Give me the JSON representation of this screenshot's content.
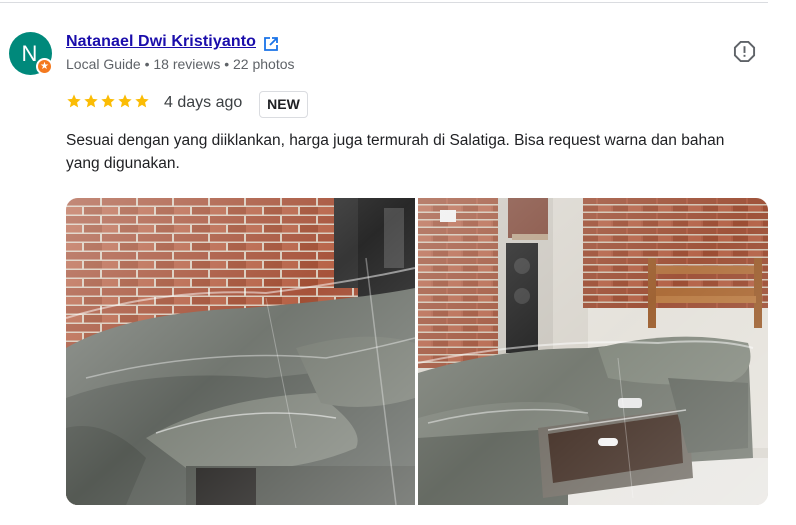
{
  "reviewer": {
    "initial": "N",
    "name": "Natanael Dwi Kristiyanto",
    "meta": "Local Guide • 18 reviews • 22 photos",
    "avatar_color": "#00897b",
    "badge_color": "#f4791f",
    "link_icon": "open-in-new-icon"
  },
  "review": {
    "rating": 5,
    "date": "4 days ago",
    "badge": "NEW",
    "text": "Sesuai dengan yang diiklankan, harga juga termurah di Salatiga. Bisa request warna dan bahan yang digunakan.",
    "star_color": "#fbbc04"
  },
  "actions": {
    "report_icon": "report-flag-icon"
  },
  "photos": [
    {
      "description_icon": "photo-sofa-wrapped"
    },
    {
      "description_icon": "photo-sofa-table-wrapped"
    }
  ]
}
